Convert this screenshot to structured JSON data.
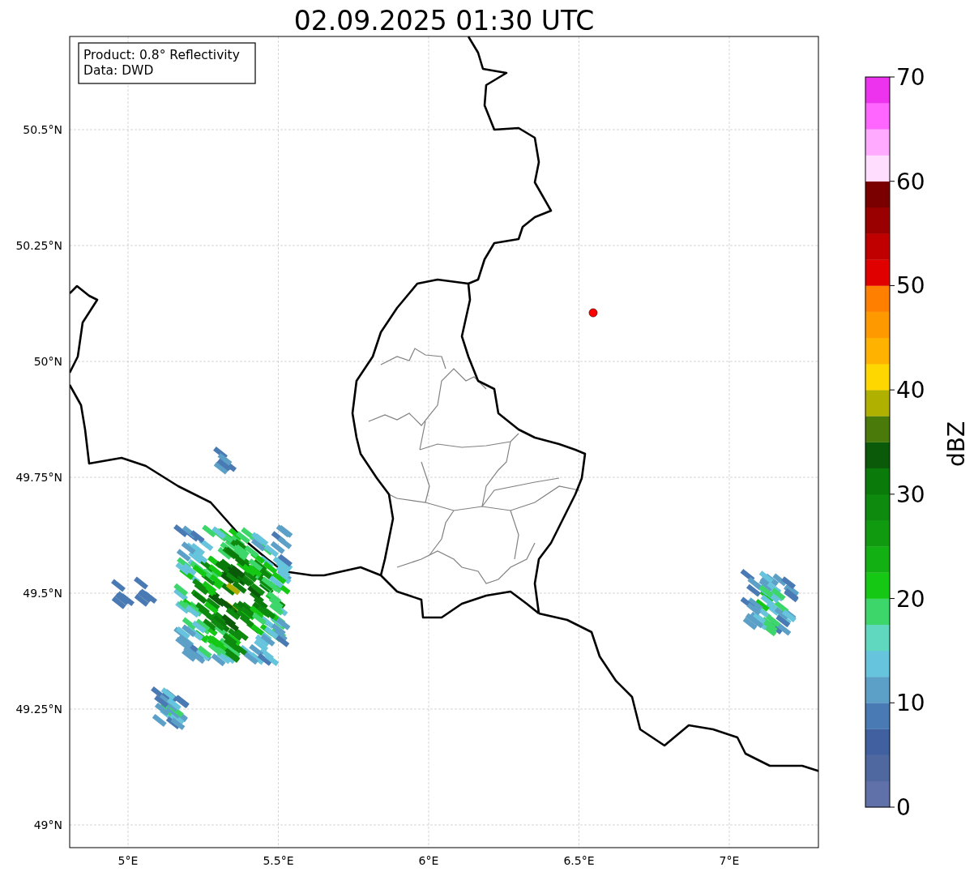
{
  "title": "02.09.2025 01:30 UTC",
  "info_box": [
    "Product: 0.8° Reflectivity",
    "Data: DWD"
  ],
  "y_ticks": [
    "50.5°N",
    "50.25°N",
    "50°N",
    "49.75°N",
    "49.5°N",
    "49.25°N",
    "49°N"
  ],
  "x_ticks": [
    "5°E",
    "5.5°E",
    "6°E",
    "6.5°E",
    "7°E"
  ],
  "colorbar": {
    "label": "dBZ",
    "ticks": [
      "70",
      "60",
      "50",
      "40",
      "30",
      "20",
      "10",
      "0"
    ],
    "segments": [
      {
        "color": "#6070a8"
      },
      {
        "color": "#5068a0"
      },
      {
        "color": "#4060a0"
      },
      {
        "color": "#4a7ab4"
      },
      {
        "color": "#5ca0c8"
      },
      {
        "color": "#66c4dc"
      },
      {
        "color": "#60d8c0"
      },
      {
        "color": "#3dd66a"
      },
      {
        "color": "#14c814"
      },
      {
        "color": "#12b012"
      },
      {
        "color": "#109a10"
      },
      {
        "color": "#0e8a0e"
      },
      {
        "color": "#0a7a0a"
      },
      {
        "color": "#0a5a0a"
      },
      {
        "color": "#4a7a0a"
      },
      {
        "color": "#b0b000"
      },
      {
        "color": "#ffd700"
      },
      {
        "color": "#ffb300"
      },
      {
        "color": "#ff9900"
      },
      {
        "color": "#ff7f00"
      },
      {
        "color": "#e00000"
      },
      {
        "color": "#c00000"
      },
      {
        "color": "#9a0000"
      },
      {
        "color": "#7a0000"
      },
      {
        "color": "#ffddff"
      },
      {
        "color": "#ffaaff"
      },
      {
        "color": "#ff66ff"
      },
      {
        "color": "#ee33ee"
      }
    ]
  }
}
